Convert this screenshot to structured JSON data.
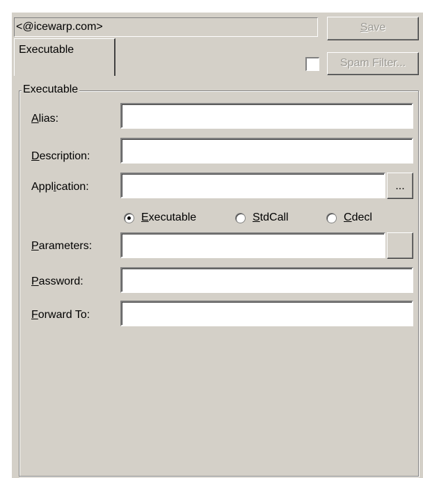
{
  "header": {
    "address_value": "<@icewarp.com>",
    "save_label": "Save",
    "save_accel": "S",
    "save_rest": "ave",
    "spam_filter_label": "Spam Filter..."
  },
  "tabs": [
    {
      "label": "Executable",
      "selected": true
    }
  ],
  "group": {
    "title": "Executable"
  },
  "fields": {
    "alias": {
      "accel": "A",
      "rest": "lias:",
      "value": ""
    },
    "description": {
      "accel": "D",
      "rest": "escription:",
      "value": ""
    },
    "application": {
      "pre": "Appl",
      "accel": "i",
      "rest": "cation:",
      "value": ""
    },
    "browse_label": "...",
    "parameters": {
      "accel": "P",
      "rest": "arameters:",
      "value": ""
    },
    "password": {
      "accel": "P",
      "rest": "assword:",
      "value": ""
    },
    "forward_to": {
      "accel": "F",
      "rest": "orward To:",
      "value": ""
    }
  },
  "call_type": {
    "selected": "Executable",
    "options": [
      {
        "accel": "E",
        "rest": "xecutable"
      },
      {
        "accel": "S",
        "rest": "tdCall"
      },
      {
        "accel": "C",
        "rest": "decl"
      }
    ]
  },
  "colors": {
    "face": "#d4d0c8",
    "disabled_text": "#9c9a94"
  }
}
